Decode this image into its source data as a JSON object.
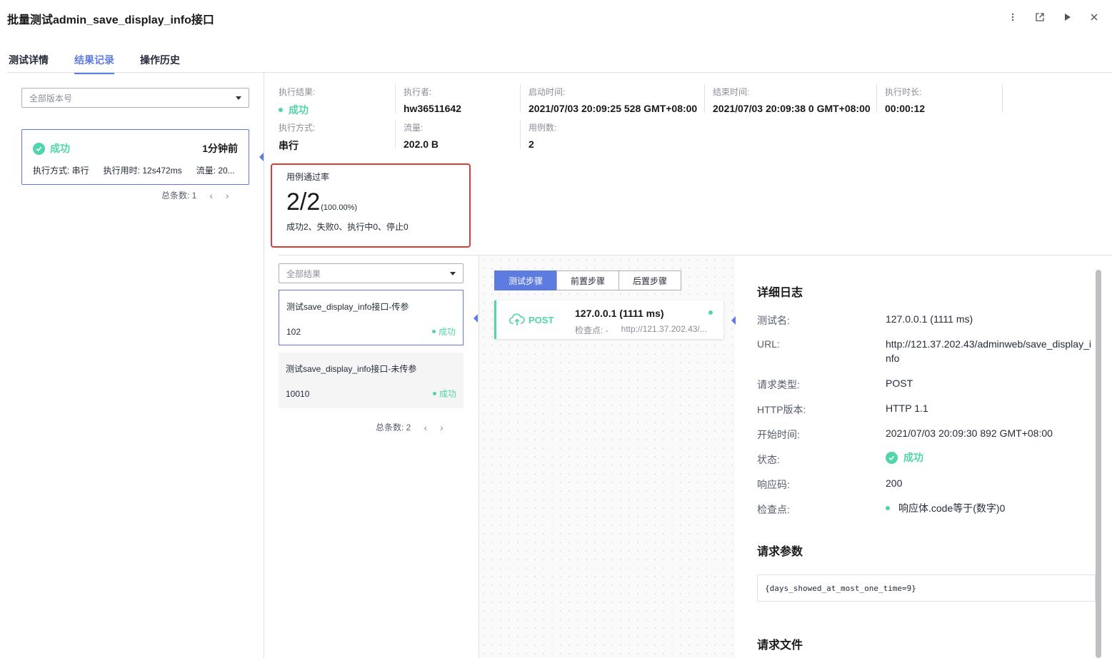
{
  "header": {
    "title": "批量测试admin_save_display_info接口"
  },
  "tabs": [
    {
      "label": "测试详情"
    },
    {
      "label": "结果记录"
    },
    {
      "label": "操作历史"
    }
  ],
  "active_tab": "结果记录",
  "left": {
    "version_select": "全部版本号",
    "record": {
      "status": "成功",
      "time_ago": "1分钟前",
      "mode": "执行方式: 串行",
      "duration": "执行用时: 12s472ms",
      "traffic": "流量: 20..."
    },
    "pager": {
      "total": "总条数: 1",
      "prev": "‹",
      "next": "›"
    }
  },
  "summary": {
    "result_label": "执行结果:",
    "result_value": "成功",
    "executor_label": "执行者:",
    "executor_value": "hw36511642",
    "start_label": "启动时间:",
    "start_value": "2021/07/03 20:09:25 528 GMT+08:00",
    "end_label": "结束时间:",
    "end_value": "2021/07/03 20:09:38 0 GMT+08:00",
    "duration_label": "执行时长:",
    "duration_value": "00:00:12",
    "mode_label": "执行方式:",
    "mode_value": "串行",
    "traffic_label": "流量:",
    "traffic_value": "202.0 B",
    "cases_label": "用例数:",
    "cases_value": "2"
  },
  "pass_rate": {
    "title": "用例通过率",
    "ratio": "2/2",
    "percent": "(100.00%)",
    "breakdown": "成功2、失败0、执行中0、停止0"
  },
  "cases": {
    "filter_select": "全部结果",
    "items": [
      {
        "name": "测试save_display_info接口-传参",
        "code": "102",
        "status": "成功"
      },
      {
        "name": "测试save_display_info接口-未传参",
        "code": "10010",
        "status": "成功"
      }
    ],
    "pager": {
      "total": "总条数: 2",
      "prev": "‹",
      "next": "›"
    }
  },
  "steps": {
    "tabs": [
      "测试步骤",
      "前置步骤",
      "后置步骤"
    ],
    "step": {
      "method": "POST",
      "title": "127.0.0.1 (1111 ms)",
      "checkpoint": "检查点:  -",
      "url": "http://121.37.202.43/..."
    }
  },
  "detail": {
    "log_title": "详细日志",
    "rows": [
      {
        "label": "测试名:",
        "value": "127.0.0.1 (1111 ms)"
      },
      {
        "label": "URL:",
        "value": "http://121.37.202.43/adminweb/save_display_info"
      },
      {
        "label": "请求类型:",
        "value": "POST"
      },
      {
        "label": "HTTP版本:",
        "value": "HTTP 1.1"
      },
      {
        "label": "开始时间:",
        "value": "2021/07/03 20:09:30 892 GMT+08:00"
      },
      {
        "label": "状态:",
        "value": "成功"
      },
      {
        "label": "响应码:",
        "value": "200"
      },
      {
        "label": "检查点:",
        "value": "响应体.code等于(数字)0"
      }
    ],
    "params_title": "请求参数",
    "params_value": "{days_showed_at_most_one_time=9}",
    "files_title": "请求文件"
  },
  "colors": {
    "accent": "#5e7ce0",
    "success": "#50d4ab",
    "highlight_border": "#e53935"
  }
}
